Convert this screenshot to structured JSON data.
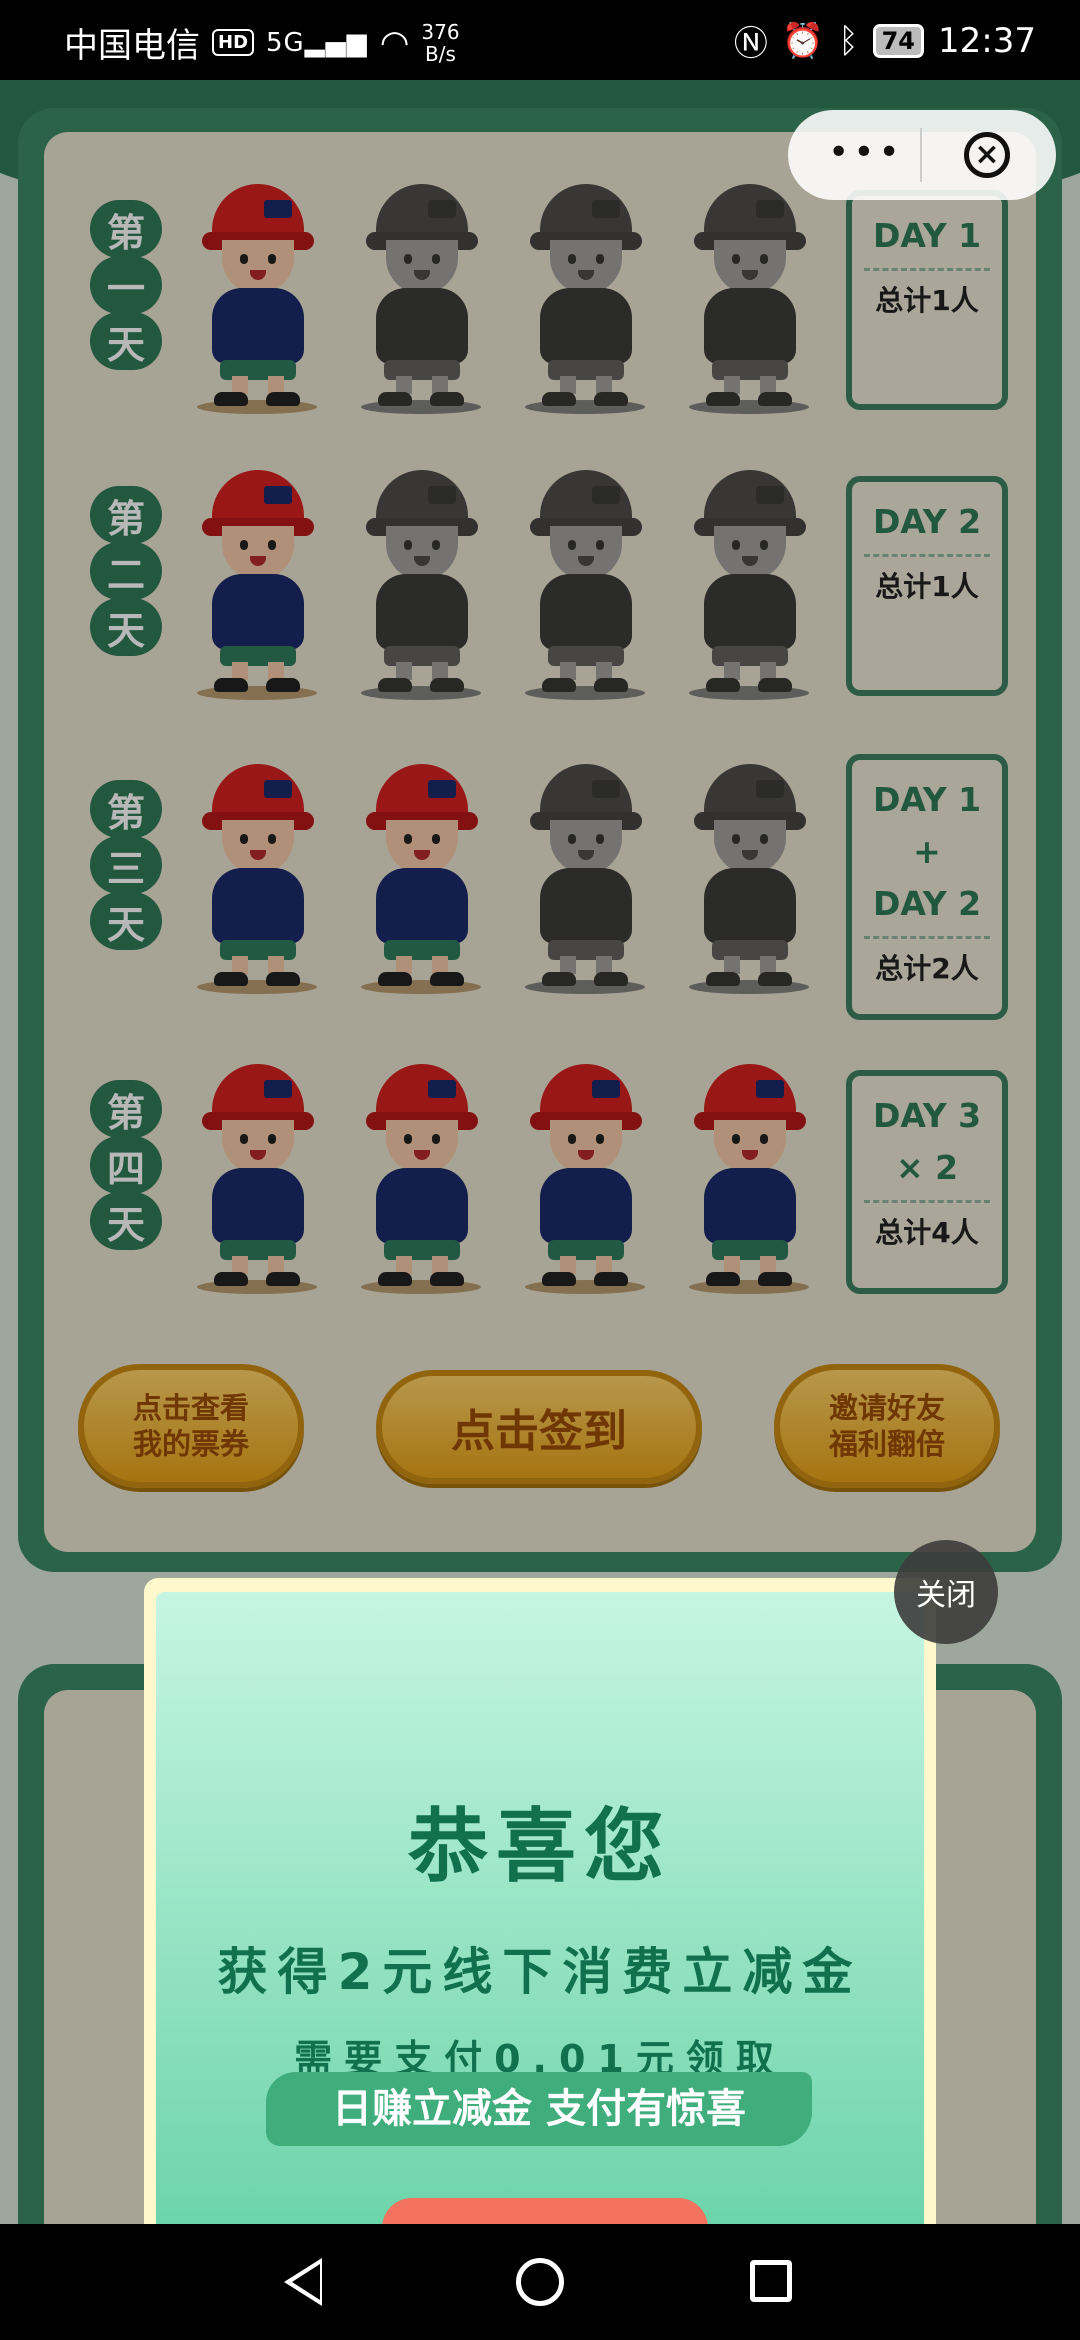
{
  "status_bar": {
    "carrier": "中国电信",
    "hd": "HD",
    "network": "5G",
    "speed_value": "376",
    "speed_unit": "B/s",
    "battery": "74",
    "time": "12:37"
  },
  "capsule": {
    "more": "•••",
    "close": "×"
  },
  "days": [
    {
      "label": [
        "第",
        "一",
        "天"
      ],
      "active_count": 1,
      "box": [
        "DAY 1"
      ],
      "total": "总计1人"
    },
    {
      "label": [
        "第",
        "二",
        "天"
      ],
      "active_count": 1,
      "box": [
        "DAY 2"
      ],
      "total": "总计1人"
    },
    {
      "label": [
        "第",
        "三",
        "天"
      ],
      "active_count": 2,
      "box": [
        "DAY 1",
        "+",
        "DAY 2"
      ],
      "total": "总计2人"
    },
    {
      "label": [
        "第",
        "四",
        "天"
      ],
      "active_count": 4,
      "box": [
        "DAY 3",
        "× 2"
      ],
      "total": "总计4人"
    }
  ],
  "buttons": {
    "tickets": [
      "点击查看",
      "我的票券"
    ],
    "checkin": "点击签到",
    "invite": [
      "邀请好友",
      "福利翻倍"
    ]
  },
  "modal": {
    "close": "关闭",
    "title": "恭喜您",
    "subtitle": "获得2元线下消费立减金",
    "note": "需要支付0.01元领取",
    "slogan": "日赚立减金 支付有惊喜"
  },
  "colors": {
    "accent": "#2e7a57",
    "gold": "#e6a217",
    "modal_start": "#c6f5e3",
    "modal_end": "#6dd4aa"
  }
}
